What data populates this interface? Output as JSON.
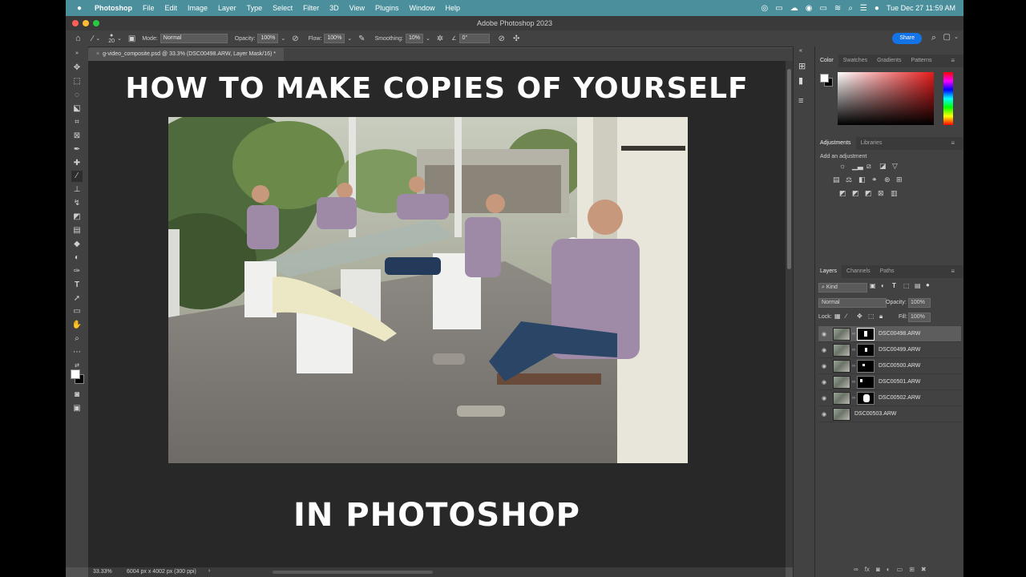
{
  "menubar": {
    "app": "Photoshop",
    "items": [
      "File",
      "Edit",
      "Image",
      "Layer",
      "Type",
      "Select",
      "Filter",
      "3D",
      "View",
      "Plugins",
      "Window",
      "Help"
    ],
    "datetime": "Tue Dec 27  11:59 AM"
  },
  "window_title": "Adobe Photoshop 2023",
  "options": {
    "brush_size": "20",
    "mode_label": "Mode:",
    "mode_value": "Normal",
    "opacity_label": "Opacity:",
    "opacity_value": "100%",
    "flow_label": "Flow:",
    "flow_value": "100%",
    "smoothing_label": "Smoothing:",
    "smoothing_value": "10%",
    "angle_value": "0°",
    "share_label": "Share"
  },
  "document_tab": "g-video_composite.psd @ 33.3% (DSC00498.ARW, Layer Mask/16) *",
  "canvas": {
    "headline_top": "HOW TO MAKE COPIES OF YOURSELF",
    "headline_bottom": "IN PHOTOSHOP"
  },
  "status": {
    "zoom": "33.33%",
    "doc_info": "6004 px x 4002 px (300 ppi)"
  },
  "color_panel": {
    "tabs": [
      "Color",
      "Swatches",
      "Gradients",
      "Patterns"
    ]
  },
  "adjustments_panel": {
    "tabs": [
      "Adjustments",
      "Libraries"
    ],
    "hint": "Add an adjustment"
  },
  "layers_panel": {
    "tabs": [
      "Layers",
      "Channels",
      "Paths"
    ],
    "filter_kind": "Kind",
    "blend_mode": "Normal",
    "opacity_label": "Opacity:",
    "opacity_value": "100%",
    "lock_label": "Lock:",
    "fill_label": "Fill:",
    "fill_value": "100%",
    "layers": [
      {
        "name": "DSC00498.ARW",
        "selected": true
      },
      {
        "name": "DSC00499.ARW",
        "selected": false
      },
      {
        "name": "DSC00500.ARW",
        "selected": false
      },
      {
        "name": "DSC00501.ARW",
        "selected": false
      },
      {
        "name": "DSC00502.ARW",
        "selected": false
      },
      {
        "name": "DSC00503.ARW",
        "selected": false
      }
    ]
  },
  "colors": {
    "menubar": "#4a8f9b",
    "share_button": "#1473e6",
    "canvas_background": "#282828"
  }
}
